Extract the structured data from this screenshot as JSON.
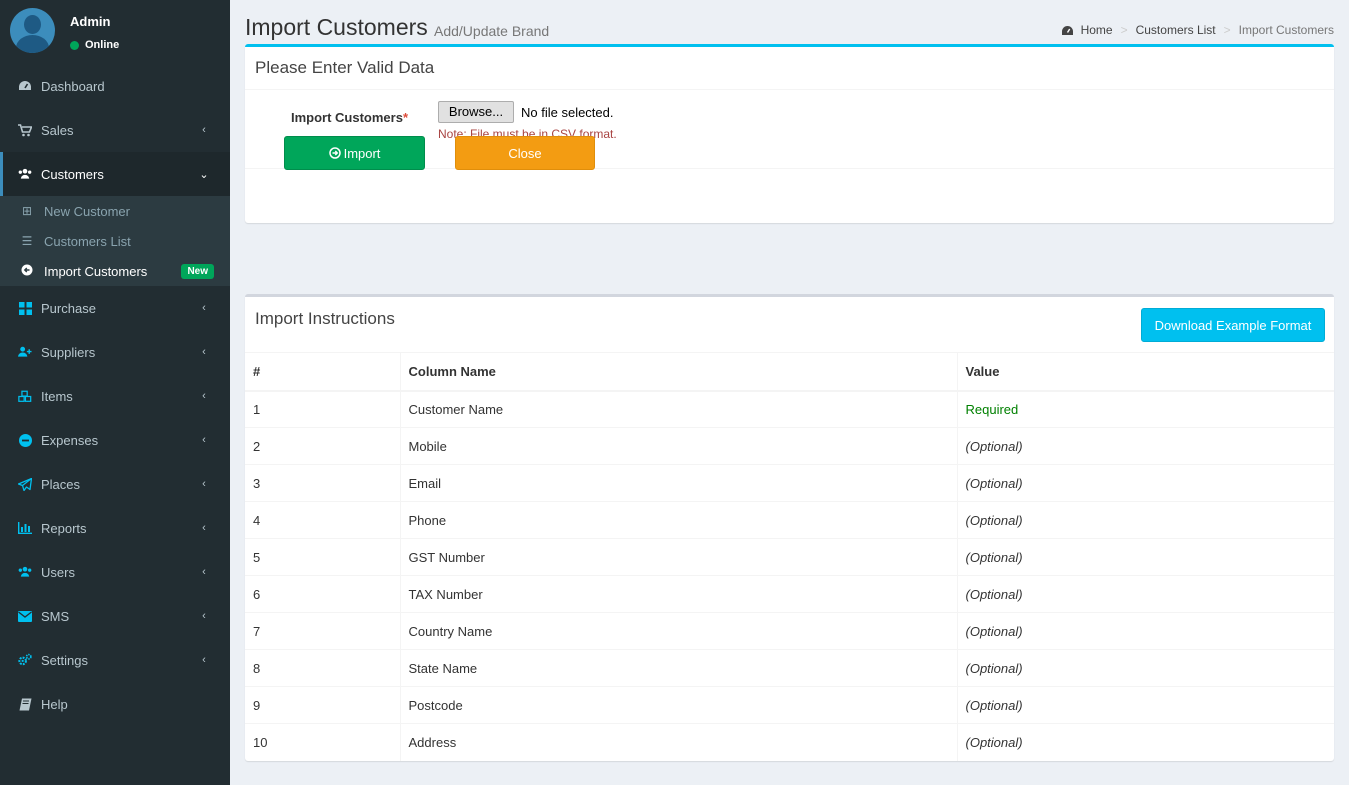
{
  "user": {
    "name": "Admin",
    "status": "Online"
  },
  "sidebar": {
    "items": [
      {
        "label": "Dashboard",
        "icon": "dashboard-icon"
      },
      {
        "label": "Sales",
        "icon": "cart-icon"
      },
      {
        "label": "Customers",
        "icon": "users-icon"
      },
      {
        "label": "Purchase",
        "icon": "grid-icon"
      },
      {
        "label": "Suppliers",
        "icon": "user-plus-icon"
      },
      {
        "label": "Items",
        "icon": "cubes-icon"
      },
      {
        "label": "Expenses",
        "icon": "minus-circle-icon"
      },
      {
        "label": "Places",
        "icon": "paper-plane-icon"
      },
      {
        "label": "Reports",
        "icon": "bar-chart-icon"
      },
      {
        "label": "Users",
        "icon": "users-icon"
      },
      {
        "label": "SMS",
        "icon": "envelope-icon"
      },
      {
        "label": "Settings",
        "icon": "cogs-icon"
      },
      {
        "label": "Help",
        "icon": "book-icon"
      }
    ],
    "submenu": [
      {
        "label": "New Customer",
        "icon": "plus-square-icon"
      },
      {
        "label": "Customers List",
        "icon": "list-icon"
      },
      {
        "label": "Import Customers",
        "icon": "arrow-circle-left-icon",
        "badge": "New"
      }
    ]
  },
  "header": {
    "title": "Import Customers",
    "subtitle": "Add/Update Brand",
    "breadcrumb": [
      "Home",
      "Customers List",
      "Import Customers"
    ]
  },
  "form": {
    "box_title": "Please Enter Valid Data",
    "label": "Import Customers",
    "required_mark": "*",
    "browse_label": "Browse...",
    "file_status": "No file selected.",
    "note": "Note: File must be in CSV format.",
    "import_label": "Import",
    "close_label": "Close"
  },
  "instructions": {
    "title": "Import Instructions",
    "download_label": "Download Example Format",
    "columns": [
      "#",
      "Column Name",
      "Value"
    ],
    "rows": [
      {
        "n": "1",
        "name": "Customer Name",
        "value": "Required"
      },
      {
        "n": "2",
        "name": "Mobile",
        "value": "(Optional)"
      },
      {
        "n": "3",
        "name": "Email",
        "value": "(Optional)"
      },
      {
        "n": "4",
        "name": "Phone",
        "value": "(Optional)"
      },
      {
        "n": "5",
        "name": "GST Number",
        "value": "(Optional)"
      },
      {
        "n": "6",
        "name": "TAX Number",
        "value": "(Optional)"
      },
      {
        "n": "7",
        "name": "Country Name",
        "value": "(Optional)"
      },
      {
        "n": "8",
        "name": "State Name",
        "value": "(Optional)"
      },
      {
        "n": "9",
        "name": "Postcode",
        "value": "(Optional)"
      },
      {
        "n": "10",
        "name": "Address",
        "value": "(Optional)"
      }
    ]
  },
  "colors": {
    "sidebar_bg": "#222d32",
    "accent_info": "#00c0ef",
    "success": "#00a65a",
    "warning": "#f39c12",
    "required_text": "#008000"
  }
}
